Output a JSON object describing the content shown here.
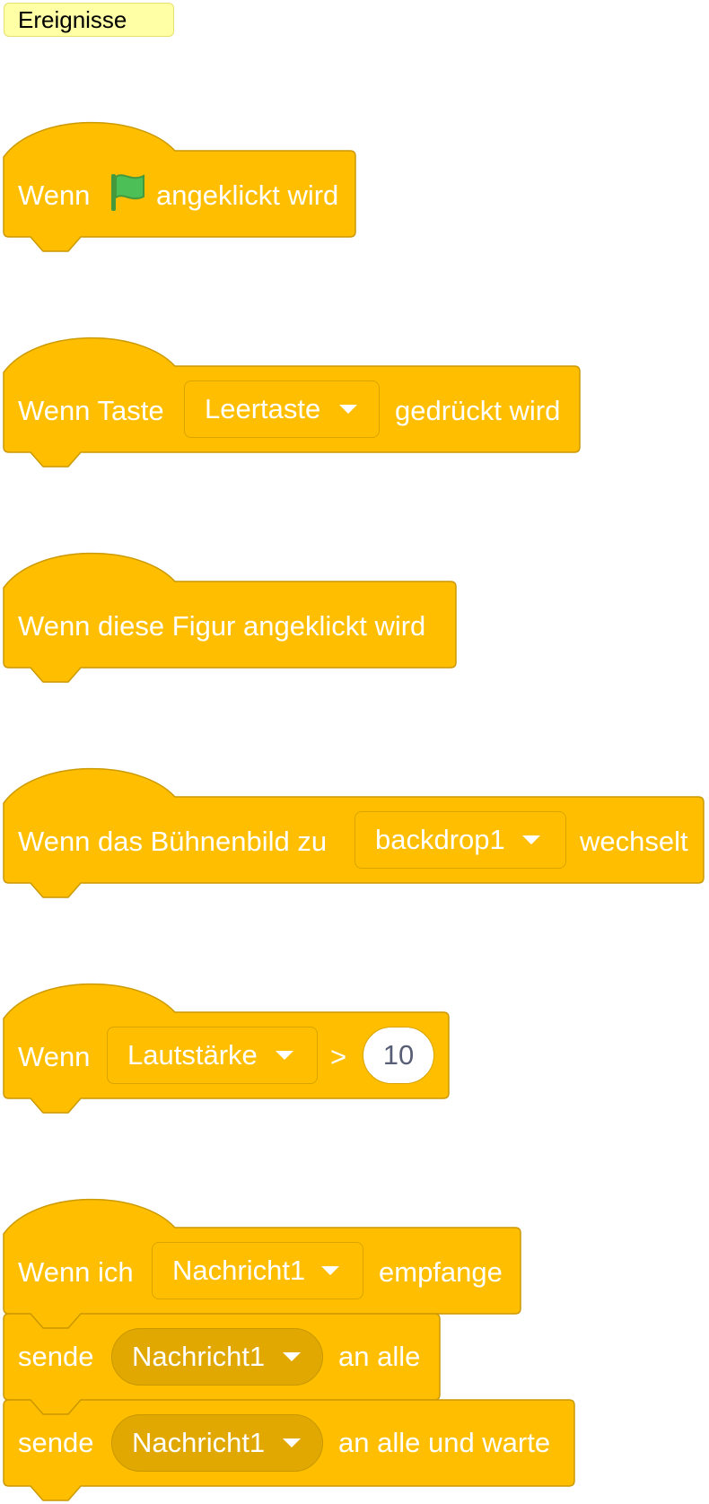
{
  "category": {
    "label": "Ereignisse"
  },
  "colors": {
    "block_fill": "#ffbf00",
    "block_stroke": "#cc9900",
    "field_fill": "#e6ac00",
    "flag_green": "#4cbf56",
    "text": "#ffffff",
    "category_bg": "#ffffa6"
  },
  "blocks": {
    "flag_clicked": {
      "text_before": "Wenn",
      "icon": "green-flag-icon",
      "text_after": "angeklickt wird"
    },
    "key_pressed": {
      "text_before": "Wenn Taste",
      "dropdown": "Leertaste",
      "text_after": "gedrückt wird"
    },
    "sprite_clicked": {
      "text": "Wenn diese Figur angeklickt wird"
    },
    "backdrop_switch": {
      "text_before": "Wenn das Bühnenbild zu",
      "dropdown": "backdrop1",
      "text_after": "wechselt"
    },
    "greater_than": {
      "text_before": "Wenn",
      "dropdown": "Lautstärke",
      "operator": ">",
      "value": "10"
    },
    "receive_message": {
      "text_before": "Wenn ich",
      "dropdown": "Nachricht1",
      "text_after": "empfange"
    },
    "broadcast": {
      "text_before": "sende",
      "dropdown": "Nachricht1",
      "text_after": "an alle"
    },
    "broadcast_wait": {
      "text_before": "sende",
      "dropdown": "Nachricht1",
      "text_after": "an alle und warte"
    }
  }
}
